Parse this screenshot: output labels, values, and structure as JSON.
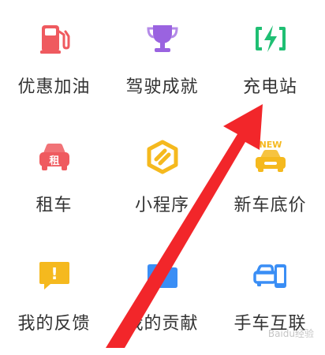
{
  "grid": {
    "items": [
      {
        "label": "优惠加油",
        "icon": "fuel-pump-icon",
        "color": "#ef5a5f"
      },
      {
        "label": "驾驶成就",
        "icon": "trophy-icon",
        "color": "#9a63e0"
      },
      {
        "label": "充电站",
        "icon": "charging-bolt-icon",
        "color": "#1fbf73"
      },
      {
        "label": "租车",
        "icon": "rental-car-icon",
        "color": "#ef5a5f",
        "badge": "租"
      },
      {
        "label": "小程序",
        "icon": "mini-program-icon",
        "color": "#f5b91e"
      },
      {
        "label": "新车底价",
        "icon": "new-car-icon",
        "color": "#f5b91e",
        "badge": "NEW"
      },
      {
        "label": "我的反馈",
        "icon": "feedback-icon",
        "color": "#f5b91e",
        "badge": "!"
      },
      {
        "label": "我的贡献",
        "icon": "folder-icon",
        "color": "#3a8ef5"
      },
      {
        "label": "手车互联",
        "icon": "phone-car-link-icon",
        "color": "#3a8ef5"
      }
    ]
  },
  "annotation": {
    "arrow_color": "#f2262a"
  },
  "watermark": {
    "text": "Baidu经验"
  }
}
